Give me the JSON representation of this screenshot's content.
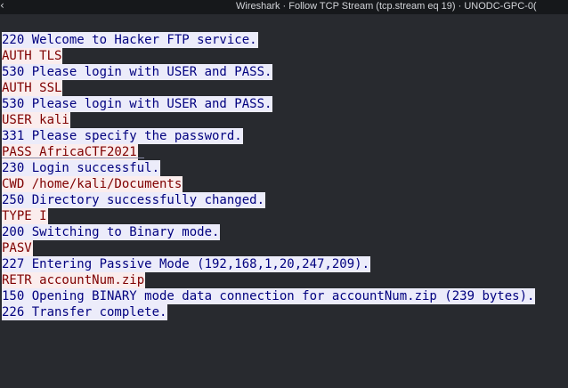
{
  "window": {
    "title": "Wireshark · Follow TCP Stream (tcp.stream eq 19) · UNODC-GPC-0(",
    "corner_glyph": "‹"
  },
  "colors": {
    "client_fg": "#7f0000",
    "client_bg": "#fbeded",
    "server_fg": "#00007f",
    "server_bg": "#ececfa",
    "pane_bg": "#282a2f"
  },
  "stream": {
    "lines": [
      {
        "dir": "server",
        "text": "220 Welcome to Hacker FTP service."
      },
      {
        "dir": "client",
        "text": "AUTH TLS"
      },
      {
        "dir": "server",
        "text": "530 Please login with USER and PASS."
      },
      {
        "dir": "client",
        "text": "AUTH SSL"
      },
      {
        "dir": "server",
        "text": "530 Please login with USER and PASS."
      },
      {
        "dir": "client",
        "text": "USER kali"
      },
      {
        "dir": "server",
        "text": "331 Please specify the password."
      },
      {
        "dir": "client",
        "text": "PASS AfricaCTF2021"
      },
      {
        "dir": "server",
        "text": "230 Login successful."
      },
      {
        "dir": "client",
        "text": "CWD /home/kali/Documents"
      },
      {
        "dir": "server",
        "text": "250 Directory successfully changed."
      },
      {
        "dir": "client",
        "text": "TYPE I"
      },
      {
        "dir": "server",
        "text": "200 Switching to Binary mode."
      },
      {
        "dir": "client",
        "text": "PASV"
      },
      {
        "dir": "server",
        "text": "227 Entering Passive Mode (192,168,1,20,247,209)."
      },
      {
        "dir": "client",
        "text": "RETR accountNum.zip"
      },
      {
        "dir": "server",
        "text": "150 Opening BINARY mode data connection for accountNum.zip (239 bytes)."
      },
      {
        "dir": "server",
        "text": "226 Transfer complete."
      }
    ]
  }
}
